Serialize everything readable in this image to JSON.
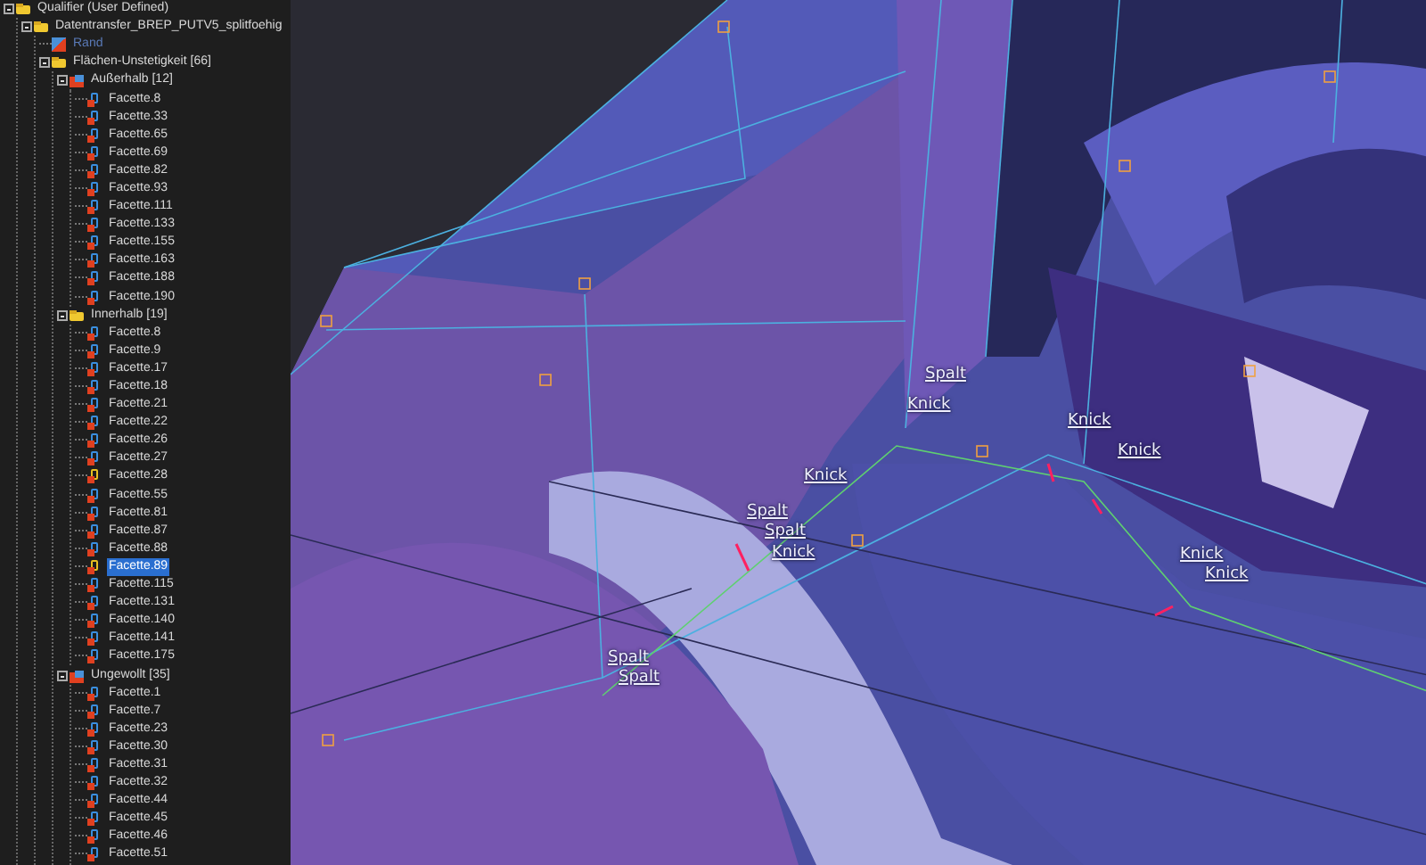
{
  "tree": [
    {
      "label": "Qualifier (User Defined)",
      "kind": "folder",
      "expanded": true,
      "children": [
        {
          "label": "Datentransfer_BREP_PUTV5_splitfoehig",
          "kind": "folder",
          "expanded": true,
          "children": [
            {
              "label": "Rand",
              "kind": "boundary",
              "dimmed": true
            },
            {
              "label": "Flächen-Unstetigkeit [66]",
              "kind": "folder",
              "dimmed": false,
              "expanded": true,
              "children": [
                {
                  "label": "Außerhalb [12]",
                  "kind": "group",
                  "expanded": true,
                  "children": [
                    {
                      "label": "Facette.8",
                      "kind": "facet",
                      "color": "#3a8fe0",
                      "selected": false
                    },
                    {
                      "label": "Facette.33",
                      "kind": "facet",
                      "color": "#3a8fe0",
                      "selected": false
                    },
                    {
                      "label": "Facette.65",
                      "kind": "facet",
                      "color": "#3a8fe0",
                      "selected": false
                    },
                    {
                      "label": "Facette.69",
                      "kind": "facet",
                      "color": "#3a8fe0",
                      "selected": false
                    },
                    {
                      "label": "Facette.82",
                      "kind": "facet",
                      "color": "#3a8fe0",
                      "selected": false
                    },
                    {
                      "label": "Facette.93",
                      "kind": "facet",
                      "color": "#3a8fe0",
                      "selected": false
                    },
                    {
                      "label": "Facette.111",
                      "kind": "facet",
                      "color": "#3a8fe0",
                      "selected": false
                    },
                    {
                      "label": "Facette.133",
                      "kind": "facet",
                      "color": "#3a8fe0",
                      "selected": false
                    },
                    {
                      "label": "Facette.155",
                      "kind": "facet",
                      "color": "#3a8fe0",
                      "selected": false
                    },
                    {
                      "label": "Facette.163",
                      "kind": "facet",
                      "color": "#3a8fe0",
                      "selected": false
                    },
                    {
                      "label": "Facette.188",
                      "kind": "facet",
                      "color": "#3a8fe0",
                      "selected": false
                    },
                    {
                      "label": "Facette.190",
                      "kind": "facet",
                      "color": "#3a8fe0",
                      "selected": false
                    }
                  ]
                },
                {
                  "label": "Innerhalb [19]",
                  "kind": "folder",
                  "expanded": true,
                  "children": [
                    {
                      "label": "Facette.8",
                      "kind": "facet",
                      "color": "#3a8fe0",
                      "selected": false
                    },
                    {
                      "label": "Facette.9",
                      "kind": "facet",
                      "color": "#3a8fe0",
                      "selected": false
                    },
                    {
                      "label": "Facette.17",
                      "kind": "facet",
                      "color": "#3a8fe0",
                      "selected": false
                    },
                    {
                      "label": "Facette.18",
                      "kind": "facet",
                      "color": "#3a8fe0",
                      "selected": false
                    },
                    {
                      "label": "Facette.21",
                      "kind": "facet",
                      "color": "#3a8fe0",
                      "selected": false
                    },
                    {
                      "label": "Facette.22",
                      "kind": "facet",
                      "color": "#3a8fe0",
                      "selected": false
                    },
                    {
                      "label": "Facette.26",
                      "kind": "facet",
                      "color": "#3a8fe0",
                      "selected": false
                    },
                    {
                      "label": "Facette.27",
                      "kind": "facet",
                      "color": "#3a8fe0",
                      "selected": false
                    },
                    {
                      "label": "Facette.28",
                      "kind": "facet",
                      "color": "#e8c020",
                      "selected": false
                    },
                    {
                      "label": "Facette.55",
                      "kind": "facet",
                      "color": "#3a8fe0",
                      "selected": false
                    },
                    {
                      "label": "Facette.81",
                      "kind": "facet",
                      "color": "#3a8fe0",
                      "selected": false
                    },
                    {
                      "label": "Facette.87",
                      "kind": "facet",
                      "color": "#3a8fe0",
                      "selected": false
                    },
                    {
                      "label": "Facette.88",
                      "kind": "facet",
                      "color": "#3a8fe0",
                      "selected": false
                    },
                    {
                      "label": "Facette.89",
                      "kind": "facet",
                      "color": "#e8c020",
                      "selected": true
                    },
                    {
                      "label": "Facette.115",
                      "kind": "facet",
                      "color": "#3a8fe0",
                      "selected": false
                    },
                    {
                      "label": "Facette.131",
                      "kind": "facet",
                      "color": "#3a8fe0",
                      "selected": false
                    },
                    {
                      "label": "Facette.140",
                      "kind": "facet",
                      "color": "#3a8fe0",
                      "selected": false
                    },
                    {
                      "label": "Facette.141",
                      "kind": "facet",
                      "color": "#3a8fe0",
                      "selected": false
                    },
                    {
                      "label": "Facette.175",
                      "kind": "facet",
                      "color": "#3a8fe0",
                      "selected": false
                    }
                  ]
                },
                {
                  "label": "Ungewollt [35]",
                  "kind": "group",
                  "expanded": true,
                  "children": [
                    {
                      "label": "Facette.1",
                      "kind": "facet",
                      "color": "#3a8fe0",
                      "selected": false
                    },
                    {
                      "label": "Facette.7",
                      "kind": "facet",
                      "color": "#3a8fe0",
                      "selected": false
                    },
                    {
                      "label": "Facette.23",
                      "kind": "facet",
                      "color": "#3a8fe0",
                      "selected": false
                    },
                    {
                      "label": "Facette.30",
                      "kind": "facet",
                      "color": "#3a8fe0",
                      "selected": false
                    },
                    {
                      "label": "Facette.31",
                      "kind": "facet",
                      "color": "#3a8fe0",
                      "selected": false
                    },
                    {
                      "label": "Facette.32",
                      "kind": "facet",
                      "color": "#3a8fe0",
                      "selected": false
                    },
                    {
                      "label": "Facette.44",
                      "kind": "facet",
                      "color": "#3a8fe0",
                      "selected": false
                    },
                    {
                      "label": "Facette.45",
                      "kind": "facet",
                      "color": "#3a8fe0",
                      "selected": false
                    },
                    {
                      "label": "Facette.46",
                      "kind": "facet",
                      "color": "#3a8fe0",
                      "selected": false
                    },
                    {
                      "label": "Facette.51",
                      "kind": "facet",
                      "color": "#3a8fe0",
                      "selected": false
                    }
                  ]
                }
              ]
            }
          ]
        }
      ]
    }
  ],
  "annotations": [
    {
      "text": "Spalt"
    },
    {
      "text": "Knick"
    },
    {
      "text": "Knick"
    },
    {
      "text": "Knick"
    },
    {
      "text": "Knick"
    },
    {
      "text": "Spalt"
    },
    {
      "text": "Spalt"
    },
    {
      "text": "Knick"
    },
    {
      "text": "Knick"
    },
    {
      "text": "Knick"
    },
    {
      "text": "Spalt"
    },
    {
      "text": "Spalt"
    }
  ]
}
